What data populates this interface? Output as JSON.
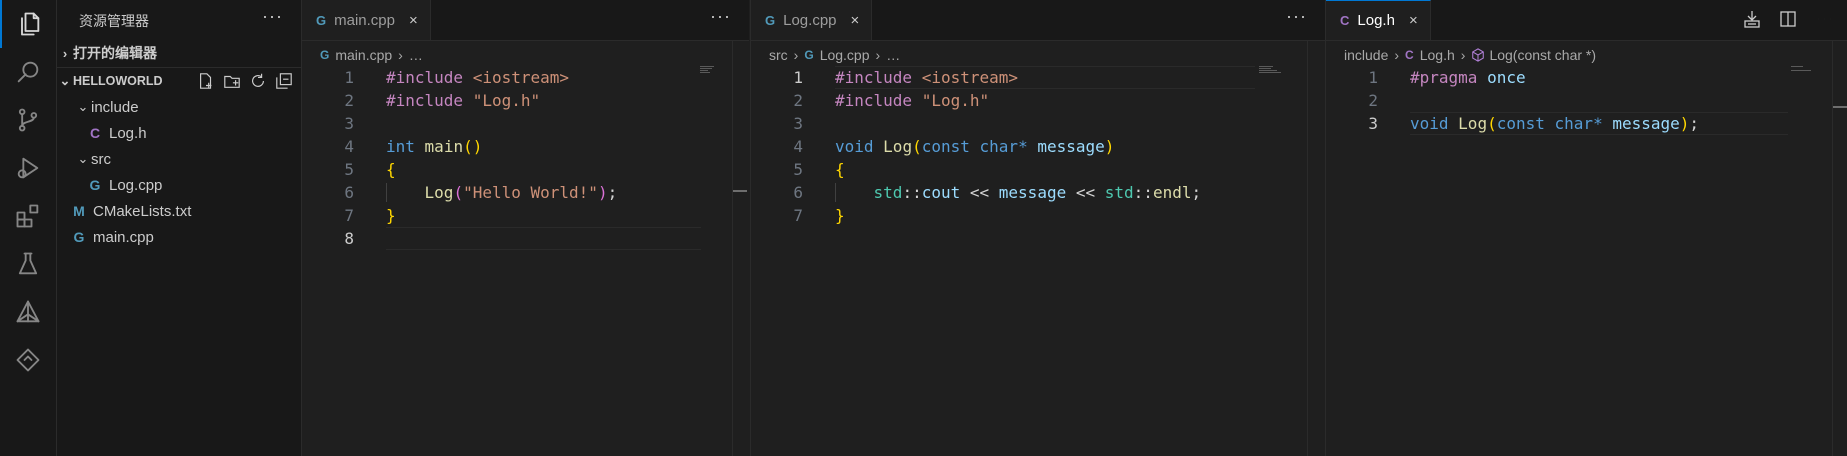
{
  "activity_bar": {
    "items": [
      {
        "icon": "files-icon",
        "active": true
      },
      {
        "icon": "search-icon"
      },
      {
        "icon": "source-control-icon"
      },
      {
        "icon": "run-debug-icon"
      },
      {
        "icon": "extensions-icon"
      },
      {
        "icon": "testing-icon"
      },
      {
        "icon": "cmake-icon"
      },
      {
        "icon": "remote-explorer-icon"
      }
    ]
  },
  "sidebar": {
    "title": "资源管理器",
    "more": "···",
    "open_editors": "打开的编辑器",
    "project": "HELLOWORLD",
    "tree": [
      {
        "label": "include",
        "type": "folder",
        "icon": "chevron-down-icon"
      },
      {
        "label": "Log.h",
        "type": "c-header",
        "icon_glyph": "C"
      },
      {
        "label": "src",
        "type": "folder",
        "icon": "chevron-down-icon"
      },
      {
        "label": "Log.cpp",
        "type": "cpp",
        "icon_glyph": "G"
      },
      {
        "label": "CMakeLists.txt",
        "type": "cmake",
        "icon_glyph": "M"
      },
      {
        "label": "main.cpp",
        "type": "cpp",
        "icon_glyph": "G"
      }
    ]
  },
  "editors": [
    {
      "tab_label": "main.cpp",
      "tab_icon": "G",
      "tab_close": "×",
      "active": false,
      "more": "···",
      "breadcrumb": [
        "main.cpp",
        "…"
      ],
      "lines": [
        "1",
        "2",
        "3",
        "4",
        "5",
        "6",
        "7",
        "8"
      ],
      "current_line": 8
    },
    {
      "tab_label": "Log.cpp",
      "tab_icon": "G",
      "tab_close": "×",
      "active": false,
      "more": "···",
      "breadcrumb": [
        "src",
        "Log.cpp",
        "…"
      ],
      "lines": [
        "1",
        "2",
        "3",
        "4",
        "5",
        "6",
        "7"
      ],
      "current_line": 1
    },
    {
      "tab_label": "Log.h",
      "tab_icon": "C",
      "tab_close": "×",
      "active": true,
      "breadcrumb": [
        "include",
        "Log.h",
        "Log(const char *)"
      ],
      "lines": [
        "1",
        "2",
        "3"
      ],
      "current_line": 3
    }
  ],
  "code": {
    "main_cpp": [
      "#include <iostream>",
      "#include \"Log.h\"",
      "",
      "int main()",
      "{",
      "    Log(\"Hello World!\");",
      "}",
      ""
    ],
    "log_cpp": [
      "#include <iostream>",
      "#include \"Log.h\"",
      "",
      "void Log(const char* message)",
      "{",
      "    std::cout << message << std::endl;",
      "}"
    ],
    "log_h": [
      "#pragma once",
      "",
      "void Log(const char* message);"
    ]
  },
  "colors": {
    "accent": "#0078d4",
    "keyword": "#569cd6",
    "preprocessor": "#c586c0",
    "string": "#ce9178",
    "function": "#dcdcaa",
    "variable": "#9cdcfe",
    "namespace": "#4ec9b0",
    "bracket": "#ffd700"
  }
}
